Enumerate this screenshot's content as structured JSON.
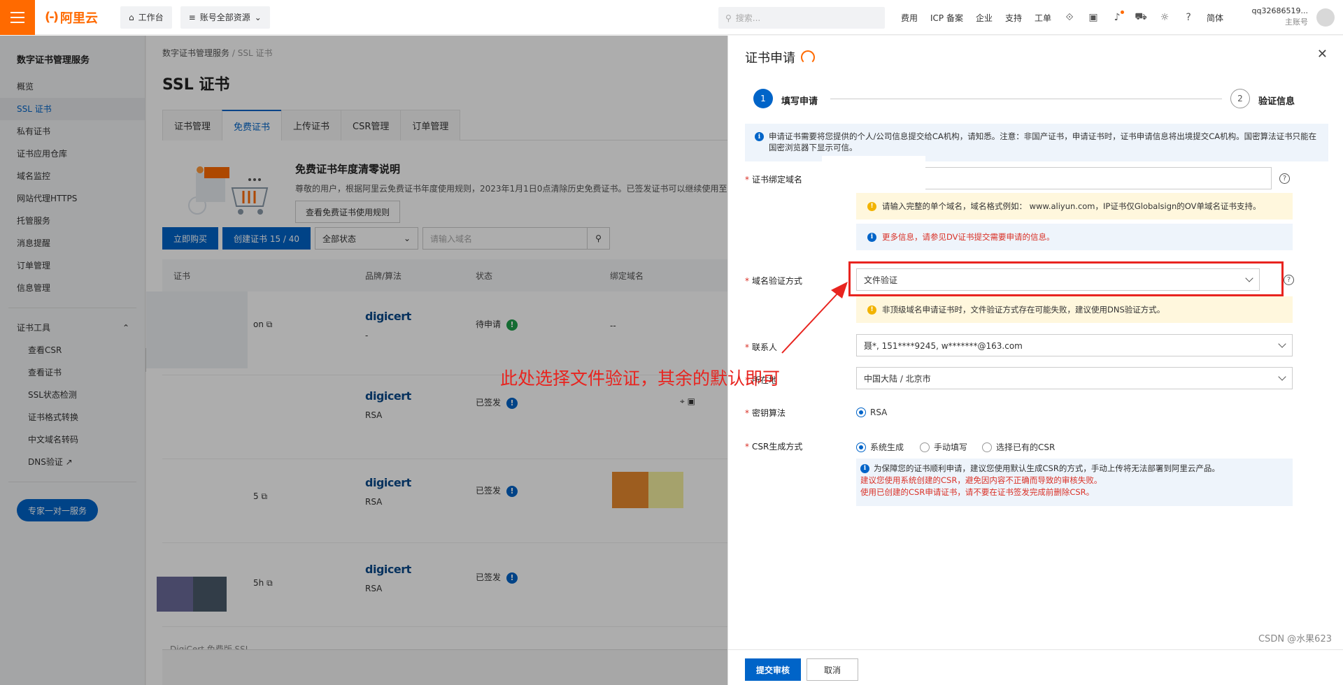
{
  "topbar": {
    "logo": "阿里云",
    "workbench": "工作台",
    "resources": "账号全部资源",
    "search_placeholder": "搜索...",
    "links": [
      "费用",
      "ICP 备案",
      "企业",
      "支持",
      "工单"
    ],
    "lang": "简体",
    "user_name": "qq32686519...",
    "user_role": "主账号"
  },
  "leftnav": {
    "title": "数字证书管理服务",
    "items": [
      "概览",
      "SSL 证书",
      "私有证书",
      "证书应用仓库",
      "域名监控",
      "网站代理HTTPS",
      "托管服务",
      "消息提醒",
      "订单管理",
      "信息管理"
    ],
    "tools_group": "证书工具",
    "tools": [
      "查看CSR",
      "查看证书",
      "SSL状态检测",
      "证书格式转换",
      "中文域名转码",
      "DNS验证"
    ],
    "expert_button": "专家一对一服务"
  },
  "main": {
    "breadcrumb": [
      "数字证书管理服务",
      "SSL 证书"
    ],
    "title": "SSL 证书",
    "tabs": [
      "证书管理",
      "免费证书",
      "上传证书",
      "CSR管理",
      "订单管理"
    ],
    "notice_title": "免费证书年度清零说明",
    "notice_text": "尊敬的用户，根据阿里云免费证书年度使用规则，2023年1月1日0点清除历史免费证书。已签发证书可以继续使用至有效",
    "notice_button": "查看免费证书使用规则",
    "buy_button": "立即购买",
    "create_button": "创建证书 15 / 40",
    "status_filter": "全部状态",
    "domain_placeholder": "请输入域名",
    "columns": [
      "证书",
      "品牌/算法",
      "状态",
      "绑定域名"
    ],
    "rows": [
      {
        "name": "on",
        "brand": "digicert",
        "algo": "-",
        "status": "待申请",
        "domain": "--"
      },
      {
        "name": "",
        "brand": "digicert",
        "algo": "RSA",
        "status": "已签发",
        "domain": ""
      },
      {
        "name": "5",
        "brand": "digicert",
        "algo": "RSA",
        "status": "已签发",
        "domain": ""
      },
      {
        "name": "5h",
        "brand": "digicert",
        "algo": "RSA",
        "status": "已签发",
        "domain": ""
      }
    ],
    "bottom_partial": "DigiCert 免费版 SSL"
  },
  "drawer": {
    "title": "证书申请",
    "steps": [
      {
        "num": "1",
        "label": "填写申请"
      },
      {
        "num": "2",
        "label": "验证信息"
      }
    ],
    "info_text": "申请证书需要将您提供的个人/公司信息提交给CA机构，请知悉。注意：非国产证书，申请证书时，证书申请信息将出境提交CA机构。国密算法证书只能在国密浏览器下显示可信。",
    "domain_label": "证书绑定域名",
    "domain_warn": "请输入完整的单个域名，域名格式例如： www.aliyun.com，IP证书仅Globalsign的OV单域名证书支持。",
    "domain_more": "更多信息，请参见DV证书提交需要申请的信息。",
    "verify_label": "域名验证方式",
    "verify_value": "文件验证",
    "verify_warn": "非顶级域名申请证书时，文件验证方式存在可能失败，建议使用DNS验证方式。",
    "contact_label": "联系人",
    "contact_value": "聂*, 151****9245, w*******@163.com",
    "region_label": "所在地",
    "region_value": "中国大陆 / 北京市",
    "algo_label": "密钥算法",
    "algo_value": "RSA",
    "csr_label": "CSR生成方式",
    "csr_options": [
      "系统生成",
      "手动填写",
      "选择已有的CSR"
    ],
    "csr_info": "为保障您的证书顺利申请，建议您使用默认生成CSR的方式，手动上传将无法部署到阿里云产品。",
    "csr_warn1": "建议您使用系统创建的CSR，避免因内容不正确而导致的审核失败。",
    "csr_warn2": "使用已创建的CSR申请证书，请不要在证书签发完成前删除CSR。",
    "submit": "提交审核",
    "cancel": "取消"
  },
  "annotation": "此处选择文件验证，其余的默认即可",
  "watermark": "CSDN @水果623",
  "colors": {
    "accent": "#0064c8",
    "brand": "#ff6a00",
    "annotation": "#e8241f"
  }
}
